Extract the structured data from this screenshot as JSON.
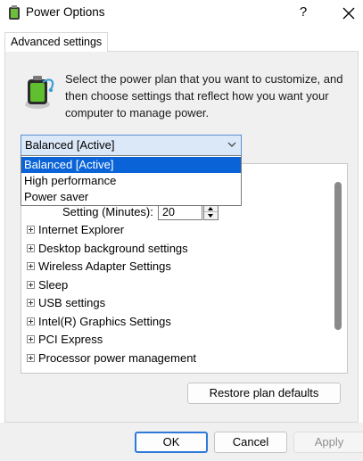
{
  "window": {
    "title": "Power Options",
    "help_label": "?"
  },
  "tab": {
    "label": "Advanced settings"
  },
  "description": "Select the power plan that you want to customize, and then choose settings that reflect how you want your computer to manage power.",
  "plan_selector": {
    "selected": "Balanced [Active]",
    "options": [
      "Balanced [Active]",
      "High performance",
      "Power saver"
    ],
    "highlighted_index": 0
  },
  "settings_tree": {
    "setting_label": "Setting (Minutes):",
    "setting_value": "20",
    "items": [
      "Internet Explorer",
      "Desktop background settings",
      "Wireless Adapter Settings",
      "Sleep",
      "USB settings",
      "Intel(R) Graphics Settings",
      "PCI Express",
      "Processor power management"
    ]
  },
  "buttons": {
    "restore": "Restore plan defaults",
    "ok": "OK",
    "cancel": "Cancel",
    "apply": "Apply"
  },
  "colors": {
    "accent": "#0a64d8",
    "select_bg": "#dbe8f7",
    "panel_bg": "#f0f0f0"
  }
}
